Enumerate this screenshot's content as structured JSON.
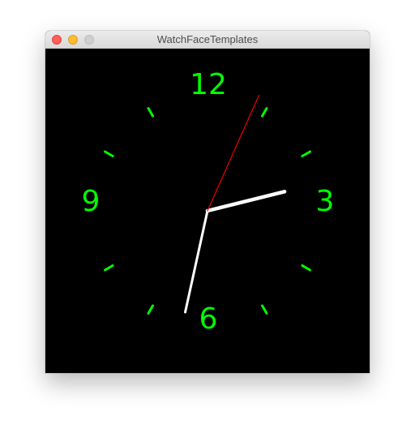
{
  "window": {
    "title": "WatchFaceTemplates"
  },
  "icons": {
    "close": "close-icon",
    "minimize": "minimize-icon",
    "zoom": "zoom-icon"
  },
  "colors": {
    "face_background": "#000000",
    "markers": "#00ff00",
    "hour_hand": "#ffffff",
    "minute_hand": "#ffffff",
    "second_hand": "#e00000"
  },
  "clock": {
    "numerals": {
      "n12": "12",
      "n3": "3",
      "n6": "6",
      "n9": "9"
    },
    "time": {
      "hours": 2,
      "minutes": 32,
      "seconds": 4
    }
  }
}
